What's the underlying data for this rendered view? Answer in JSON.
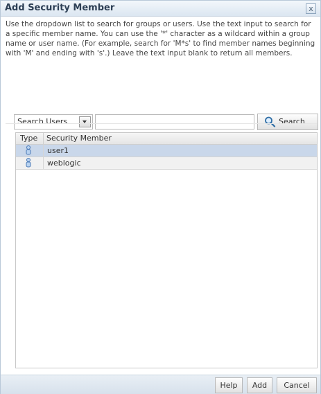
{
  "dialog": {
    "title": "Add Security Member",
    "close_label": "x",
    "description": "Use the dropdown list to search for groups or users. Use the text input to search for a specific member name. You can use the '*' character as a wildcard within a group name or user name. (For example, search for 'M*s' to find member names beginning with 'M' and ending with 's'.) Leave the text input blank to return all members."
  },
  "search": {
    "type_selected": "Search Users",
    "input_value": "",
    "button_label": "Search"
  },
  "table": {
    "columns": [
      "Type",
      "Security Member"
    ],
    "rows": [
      {
        "type_icon": "user-icon",
        "member": "user1"
      },
      {
        "type_icon": "user-icon",
        "member": "weblogic"
      }
    ]
  },
  "footer": {
    "help": "Help",
    "add": "Add",
    "cancel": "Cancel"
  },
  "colors": {
    "selected_row": "#c9d7ea",
    "title_text": "#2d3f55"
  }
}
